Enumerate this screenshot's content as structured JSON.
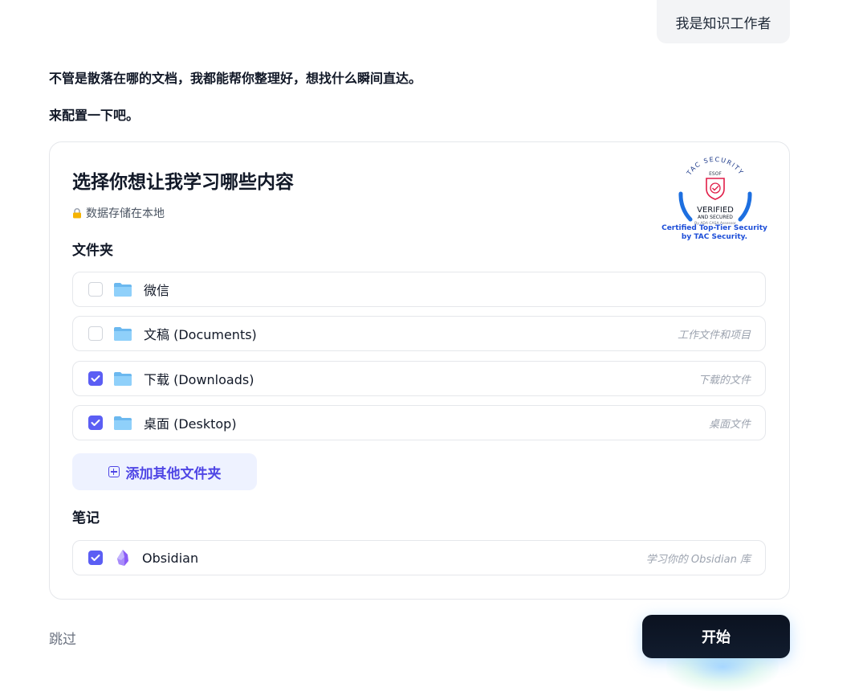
{
  "user_message": "我是知识工作者",
  "assistant": {
    "line1": "不管是散落在哪的文档，我都能帮你整理好，想找什么瞬间直达。",
    "line2": "来配置一下吧。"
  },
  "card": {
    "title": "选择你想让我学习哪些内容",
    "privacy_note": "数据存储在本地",
    "badge": {
      "ring_text": "TAC SECURITY",
      "top_text": "ESOF",
      "verified": "VERIFIED",
      "secured": "AND SECURED",
      "assessor": "By ADA CASA Assessor",
      "caption_line1": "Certified Top-Tier Security",
      "caption_line2": "by TAC Security."
    },
    "folders_label": "文件夹",
    "folders": [
      {
        "label": "微信",
        "desc": "",
        "checked": false,
        "icon": "folder-icon"
      },
      {
        "label": "文稿 (Documents)",
        "desc": "工作文件和项目",
        "checked": false,
        "icon": "folder-icon"
      },
      {
        "label": "下载 (Downloads)",
        "desc": "下载的文件",
        "checked": true,
        "icon": "folder-icon"
      },
      {
        "label": "桌面 (Desktop)",
        "desc": "桌面文件",
        "checked": true,
        "icon": "folder-icon"
      }
    ],
    "add_folder_label": "添加其他文件夹",
    "notes_label": "笔记",
    "notes": [
      {
        "label": "Obsidian",
        "desc": "学习你的 Obsidian 库",
        "checked": true,
        "icon": "obsidian-icon"
      }
    ]
  },
  "footer": {
    "skip_label": "跳过",
    "start_label": "开始"
  },
  "colors": {
    "accent": "#5b5ef4",
    "folder": "#7cc4f5",
    "badge_blue": "#1d4ed8",
    "badge_red": "#e11d48",
    "start_bg": "#0b1220"
  }
}
